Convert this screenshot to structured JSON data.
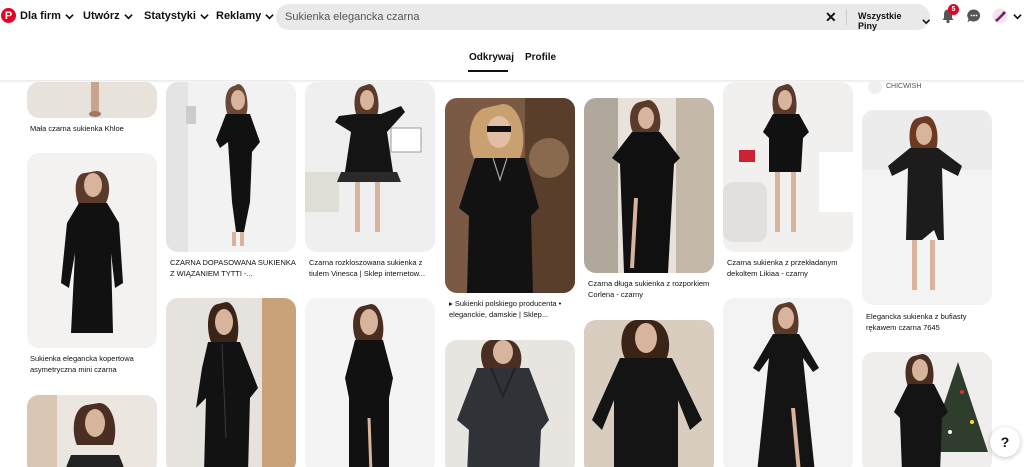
{
  "nav": {
    "logo": "P",
    "business": "Dla firm",
    "create": "Utwórz",
    "analytics": "Statystyki",
    "ads": "Reklamy"
  },
  "search": {
    "value": "Sukienka elegancka czarna",
    "scope": "Wszystkie Piny",
    "clear_icon": "close-icon"
  },
  "notifications": {
    "count": "5"
  },
  "tabs": {
    "explore": "Odkrywaj",
    "profile": "Profile"
  },
  "colors": {
    "accent": "#e60023",
    "search_bg": "#e9e9e9"
  },
  "pins": {
    "p1": "Mała czarna sukienka Khloe",
    "p2": "Sukienka elegancka kopertowa asymetryczna mini czarna",
    "p3": "CZARNA DOPASOWANA SUKIENKA Z WIĄZANIEM TYTTI -...",
    "p4": "Czarna rozkloszowana sukienka z tiulem Vinesca | Sklep internetow...",
    "p5": "▸ Sukienki polskiego producenta • eleganckie, damskie | Sklep...",
    "p6": "Czarna długa sukienka z rozporkiem Corlena - czarny",
    "p7": "Czarna sukienka z przekładanym dekoltem Likiaa - czarny",
    "p8": "Elegancka sukienka z bufiasty rękawem czarna 7645",
    "brand": "CHICWISH"
  },
  "help": "?"
}
